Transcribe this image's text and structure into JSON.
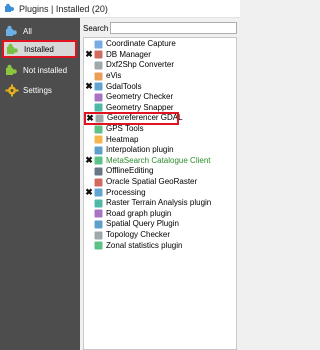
{
  "window": {
    "title": "Plugins | Installed (20)"
  },
  "sidebar": {
    "items": [
      {
        "label": "All",
        "icon": "puzzle-icon",
        "selected": false
      },
      {
        "label": "Installed",
        "icon": "installed-puzzle-icon",
        "selected": true
      },
      {
        "label": "Not installed",
        "icon": "not-installed-puzzle-icon",
        "selected": false
      },
      {
        "label": "Settings",
        "icon": "gear-icon",
        "selected": false
      }
    ]
  },
  "search": {
    "label": "Search",
    "value": ""
  },
  "plugins": [
    {
      "label": "Coordinate Capture",
      "checked": false,
      "icon": "coordinate-icon"
    },
    {
      "label": "DB Manager",
      "checked": true,
      "icon": "database-icon"
    },
    {
      "label": "Dxf2Shp Converter",
      "checked": false,
      "icon": "dxf-icon"
    },
    {
      "label": "eVis",
      "checked": false,
      "icon": "evis-icon"
    },
    {
      "label": "GdalTools",
      "checked": true,
      "icon": "gdal-icon"
    },
    {
      "label": "Geometry Checker",
      "checked": false,
      "icon": "geometry-checker-icon"
    },
    {
      "label": "Geometry Snapper",
      "checked": false,
      "icon": "geometry-snapper-icon"
    },
    {
      "label": "Georeferencer GDAL",
      "checked": true,
      "icon": "georeferencer-icon",
      "highlight": true
    },
    {
      "label": "GPS Tools",
      "checked": false,
      "icon": "gps-icon"
    },
    {
      "label": "Heatmap",
      "checked": false,
      "icon": "heatmap-icon"
    },
    {
      "label": "Interpolation plugin",
      "checked": false,
      "icon": "interpolation-icon"
    },
    {
      "label": "MetaSearch Catalogue Client",
      "checked": true,
      "icon": "metasearch-icon",
      "green": true
    },
    {
      "label": "OfflineEditing",
      "checked": false,
      "icon": "offline-editing-icon"
    },
    {
      "label": "Oracle Spatial GeoRaster",
      "checked": false,
      "icon": "oracle-icon"
    },
    {
      "label": "Processing",
      "checked": true,
      "icon": "processing-icon"
    },
    {
      "label": "Raster Terrain Analysis plugin",
      "checked": false,
      "icon": "terrain-icon"
    },
    {
      "label": "Road graph plugin",
      "checked": false,
      "icon": "road-graph-icon"
    },
    {
      "label": "Spatial Query Plugin",
      "checked": false,
      "icon": "spatial-query-icon"
    },
    {
      "label": "Topology Checker",
      "checked": false,
      "icon": "topology-icon"
    },
    {
      "label": "Zonal statistics plugin",
      "checked": false,
      "icon": "zonal-stats-icon"
    }
  ],
  "colors": {
    "sidebar_bg": "#4d4d4d",
    "highlight_border": "#e0141e",
    "green_text": "#2e8b2e"
  }
}
